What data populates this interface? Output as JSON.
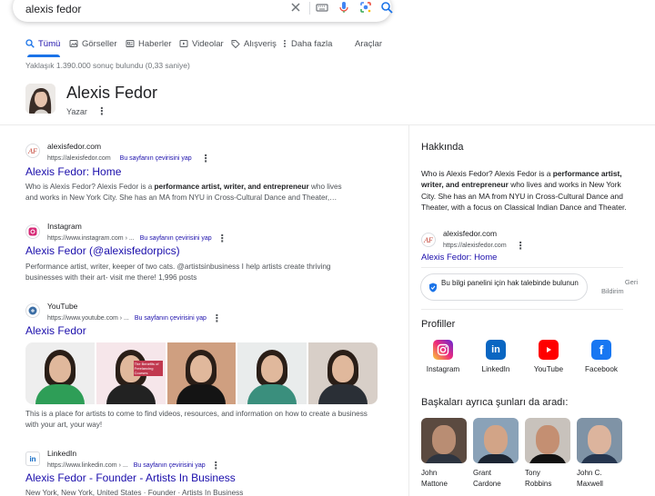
{
  "search": {
    "query": "alexis fedor"
  },
  "tabs": [
    {
      "label": "Tümü",
      "icon": "search-icon"
    },
    {
      "label": "Görseller",
      "icon": "image-icon"
    },
    {
      "label": "Haberler",
      "icon": "news-icon"
    },
    {
      "label": "Videolar",
      "icon": "play-icon"
    },
    {
      "label": "Alışveriş",
      "icon": "tag-icon"
    },
    {
      "label": "Daha fazla",
      "icon": "more-vert-icon"
    }
  ],
  "tools_label": "Araçlar",
  "results_count": "Yaklaşık 1.390.000 sonuç bulundu (0,33 saniye)",
  "entity": {
    "name": "Alexis Fedor",
    "type": "Yazar"
  },
  "results": [
    {
      "site": "alexisfedor.com",
      "url": "https://alexisfedor.com",
      "translate": "Bu sayfanın çevirisini yap",
      "title": "Alexis Fedor: Home",
      "snippet_a": "Who is Alexis Fedor? Alexis Fedor is a ",
      "snippet_b": "performance artist, writer, and entrepreneur",
      "snippet_c": " who lives and works in New York City. She has an MA from NYU in Cross-Cultural Dance and Theater,…"
    },
    {
      "site": "Instagram",
      "url": "https://www.instagram.com › ...",
      "translate": "Bu sayfanın çevirisini yap",
      "title": "Alexis Fedor (@alexisfedorpics)",
      "snippet": "Performance artist, writer, keeper of two cats. @artistsinbusiness I help artists create thriving businesses with their art- visit me there! 1,996 posts"
    },
    {
      "site": "YouTube",
      "url": "https://www.youtube.com › ...",
      "translate": "Bu sayfanın çevirisini yap",
      "title": "Alexis Fedor",
      "thumb_caption": "The Benefits of Freelancing Courses",
      "snippet": "This is a place for artists to come to find videos, resources, and information on how to create a business with your art, your way!"
    },
    {
      "site": "LinkedIn",
      "url": "https://www.linkedin.com › ...",
      "translate": "Bu sayfanın çevirisini yap",
      "title": "Alexis Fedor - Founder - Artists In Business",
      "snippet": "New York, New York, United States · Founder · Artists In Business"
    }
  ],
  "panel": {
    "heading": "Hakkında",
    "about_a": "Who is Alexis Fedor? Alexis Fedor is a ",
    "about_b": "performance artist, writer, and entrepreneur",
    "about_c": " who lives and works in New York City. She has an MA from NYU in Cross-Cultural Dance and Theater, with a focus on Classical Indian Dance and Theater.",
    "source_site": "alexisfedor.com",
    "source_url": "https://alexisfedor.com",
    "source_title": "Alexis Fedor: Home",
    "claim_label": "Bu bilgi panelini için hak talebinde bulunun",
    "feedback_a": "Geri",
    "feedback_b": "Bildirim",
    "profiles_heading": "Profiller",
    "profiles": [
      {
        "label": "Instagram",
        "icon": "instagram-icon",
        "color": "#d62976"
      },
      {
        "label": "LinkedIn",
        "icon": "linkedin-icon",
        "color": "#0a66c2"
      },
      {
        "label": "YouTube",
        "icon": "youtube-icon",
        "color": "#ff0000"
      },
      {
        "label": "Facebook",
        "icon": "facebook-icon",
        "color": "#1877f2"
      }
    ],
    "people_heading": "Başkaları ayrıca şunları da aradı:",
    "people": [
      {
        "line1": "John",
        "line2": "Mattone"
      },
      {
        "line1": "Grant",
        "line2": "Cardone"
      },
      {
        "line1": "Tony",
        "line2": "Robbins"
      },
      {
        "line1": "John C.",
        "line2": "Maxwell"
      }
    ]
  },
  "colors": {
    "link": "#1a0dab",
    "accent": "#1a73e8",
    "muted": "#4d5156"
  }
}
